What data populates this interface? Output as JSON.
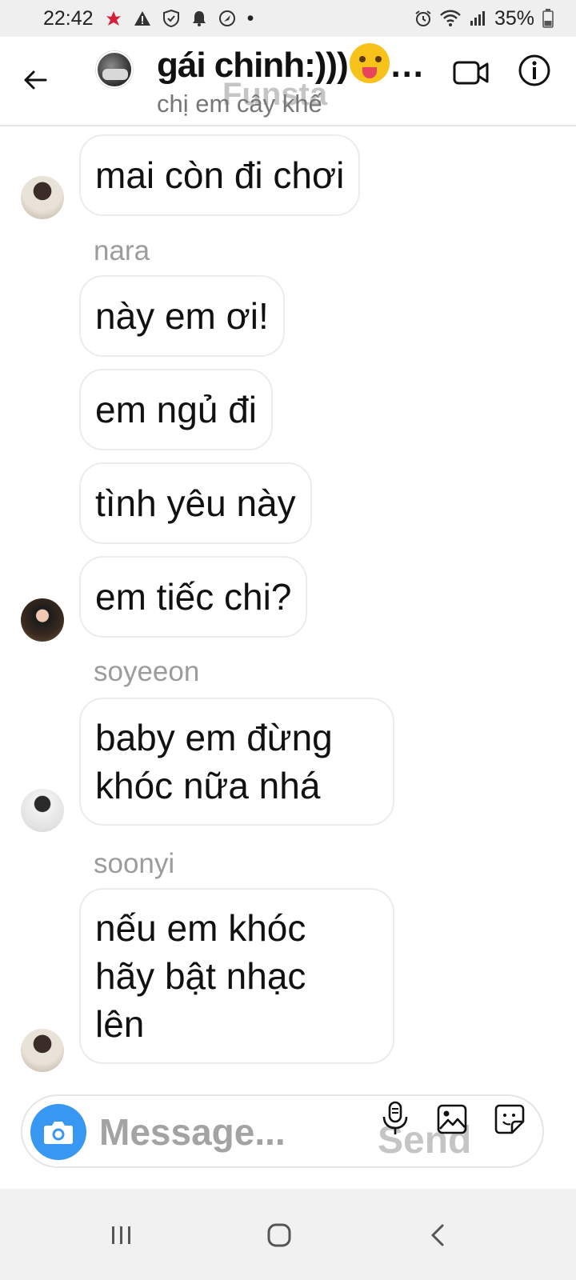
{
  "status_bar": {
    "time": "22:42",
    "dot": "•",
    "battery": "35%",
    "icons": [
      "app-notification-icon",
      "warning-icon",
      "shield-icon",
      "bell-icon",
      "vpn-icon",
      "alarm-icon",
      "wifi-icon",
      "signal-icon",
      "battery-icon"
    ]
  },
  "header": {
    "title": "gái chinh:)))",
    "title_ellipsis": "…",
    "subtitle": "chị em cây khế",
    "watermark": "Funsta"
  },
  "messages": [
    {
      "text": "mai còn đi chơi"
    },
    {
      "sender": "nara"
    },
    {
      "text": "này em ơi!"
    },
    {
      "text": "em ngủ đi"
    },
    {
      "text": "tình yêu này"
    },
    {
      "text": "em tiếc chi?"
    },
    {
      "sender": "soyeeon"
    },
    {
      "text_lines": [
        "baby em đừng",
        "khóc nữa nhá"
      ]
    },
    {
      "sender": "soonyi"
    },
    {
      "text_lines": [
        "nếu em khóc",
        "hãy bật nhạc",
        "lên"
      ]
    }
  ],
  "composer": {
    "placeholder": "Message...",
    "watermark": "Send"
  },
  "colors": {
    "accent": "#3897f0",
    "bubble_border": "#ececec",
    "sender_text": "#9c9c9c"
  }
}
